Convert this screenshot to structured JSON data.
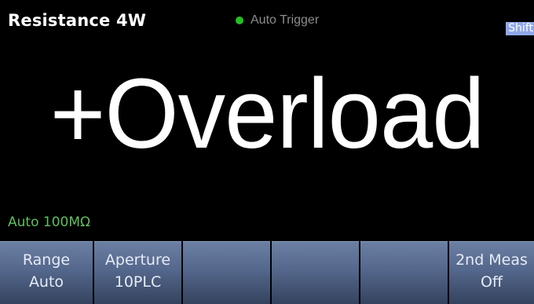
{
  "header": {
    "function_title": "Resistance 4W",
    "trigger_mode": "Auto Trigger",
    "shift_indicator": "Shift"
  },
  "measurement": {
    "reading": "+Overload",
    "range_info": "Auto 100MΩ"
  },
  "softkeys": [
    {
      "label": "Range",
      "value": "Auto"
    },
    {
      "label": "Aperture",
      "value": "10PLC"
    },
    {
      "label": "",
      "value": ""
    },
    {
      "label": "",
      "value": ""
    },
    {
      "label": "",
      "value": ""
    },
    {
      "label": "2nd Meas",
      "value": "Off"
    }
  ],
  "colors": {
    "background": "#000000",
    "trigger_dot": "#22c022",
    "range_text": "#5fbf5f",
    "shift_badge": "#8fa8e8",
    "softkey_top": "#6b7fa3",
    "softkey_bottom": "#34435e"
  }
}
